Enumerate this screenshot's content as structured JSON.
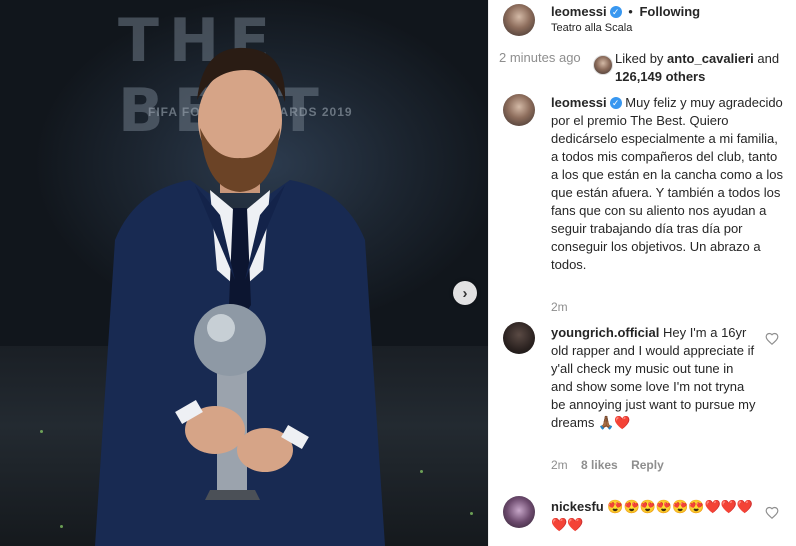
{
  "photo": {
    "logo_text": "THE BEST",
    "subtitle": "FIFA FOOTBALL AWARDS 2019",
    "next_icon": "chevron-right-icon"
  },
  "header": {
    "username": "leomessi",
    "separator": "•",
    "follow_status": "Following",
    "location": "Teatro alla Scala"
  },
  "likes": {
    "time_ago": "2 minutes ago",
    "liked_by_prefix": "Liked by",
    "liked_by_user": "anto_cavalieri",
    "and": "and",
    "others": "126,149 others"
  },
  "caption": {
    "username": "leomessi",
    "text": "Muy feliz y muy agradecido por el premio The Best. Quiero dedicárselo especialmente a mi familia, a todos mis compañeros del club, tanto a los que están en la cancha como a los que están afuera. Y también a todos los fans que con su aliento nos ayudan a seguir trabajando día tras día por conseguir los objetivos. Un abrazo a todos.",
    "time": "2m"
  },
  "comments": [
    {
      "username": "youngrich.official",
      "text": "Hey I'm a 16yr old rapper and I would appreciate if y'all check my music out tune in and show some love I'm not tryna be annoying just want to pursue my dreams ",
      "emoji": "🙏🏾❤️",
      "time": "2m",
      "likes": "8 likes",
      "reply": "Reply"
    },
    {
      "username": "nickesfu",
      "text": "😍😍😍😍😍😍❤️❤️❤️❤️❤️"
    }
  ],
  "colors": {
    "verified": "#3897f0",
    "heart_red": "#ed4956"
  }
}
